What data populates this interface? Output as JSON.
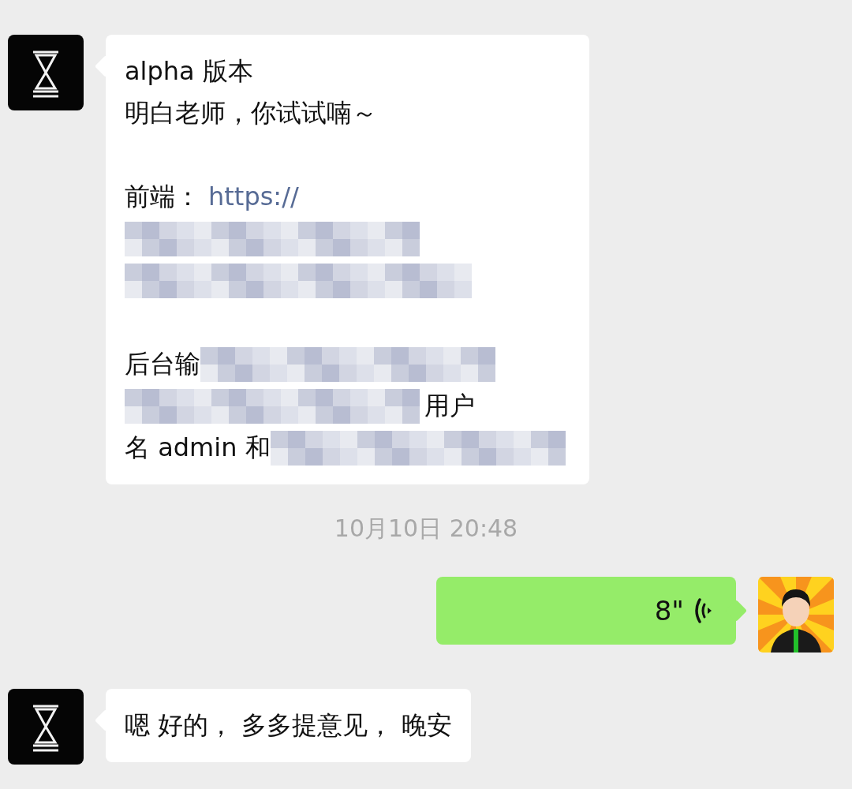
{
  "messages": [
    {
      "kind": "text",
      "outgoing": false,
      "lines": [
        {
          "kind": "text",
          "segments": [
            {
              "kind": "text",
              "text": "alpha 版本"
            }
          ]
        },
        {
          "kind": "text",
          "segments": [
            {
              "kind": "text",
              "text": "明白老师，你试试喃～"
            }
          ]
        },
        {
          "kind": "blank"
        },
        {
          "kind": "text",
          "segments": [
            {
              "kind": "text",
              "text": "前端："
            },
            {
              "kind": "link",
              "text": "https://"
            }
          ]
        },
        {
          "kind": "text",
          "segments": [
            {
              "kind": "redacted"
            }
          ]
        },
        {
          "kind": "text",
          "segments": [
            {
              "kind": "redacted"
            }
          ]
        },
        {
          "kind": "blank"
        },
        {
          "kind": "text",
          "segments": [
            {
              "kind": "text",
              "text": "后台输"
            },
            {
              "kind": "redacted"
            }
          ]
        },
        {
          "kind": "text",
          "segments": [
            {
              "kind": "redacted"
            },
            {
              "kind": "text",
              "text": "用户"
            }
          ]
        },
        {
          "kind": "text",
          "segments": [
            {
              "kind": "text",
              "text": "名 admin 和"
            },
            {
              "kind": "redacted"
            }
          ]
        }
      ]
    },
    {
      "kind": "timestamp",
      "text": "10月10日 20:48"
    },
    {
      "kind": "voice",
      "outgoing": true,
      "duration": "8\""
    },
    {
      "kind": "text",
      "outgoing": false,
      "lines": [
        {
          "kind": "text",
          "segments": [
            {
              "kind": "text",
              "text": "嗯 好的， 多多提意见， 晚安"
            }
          ]
        }
      ]
    }
  ]
}
